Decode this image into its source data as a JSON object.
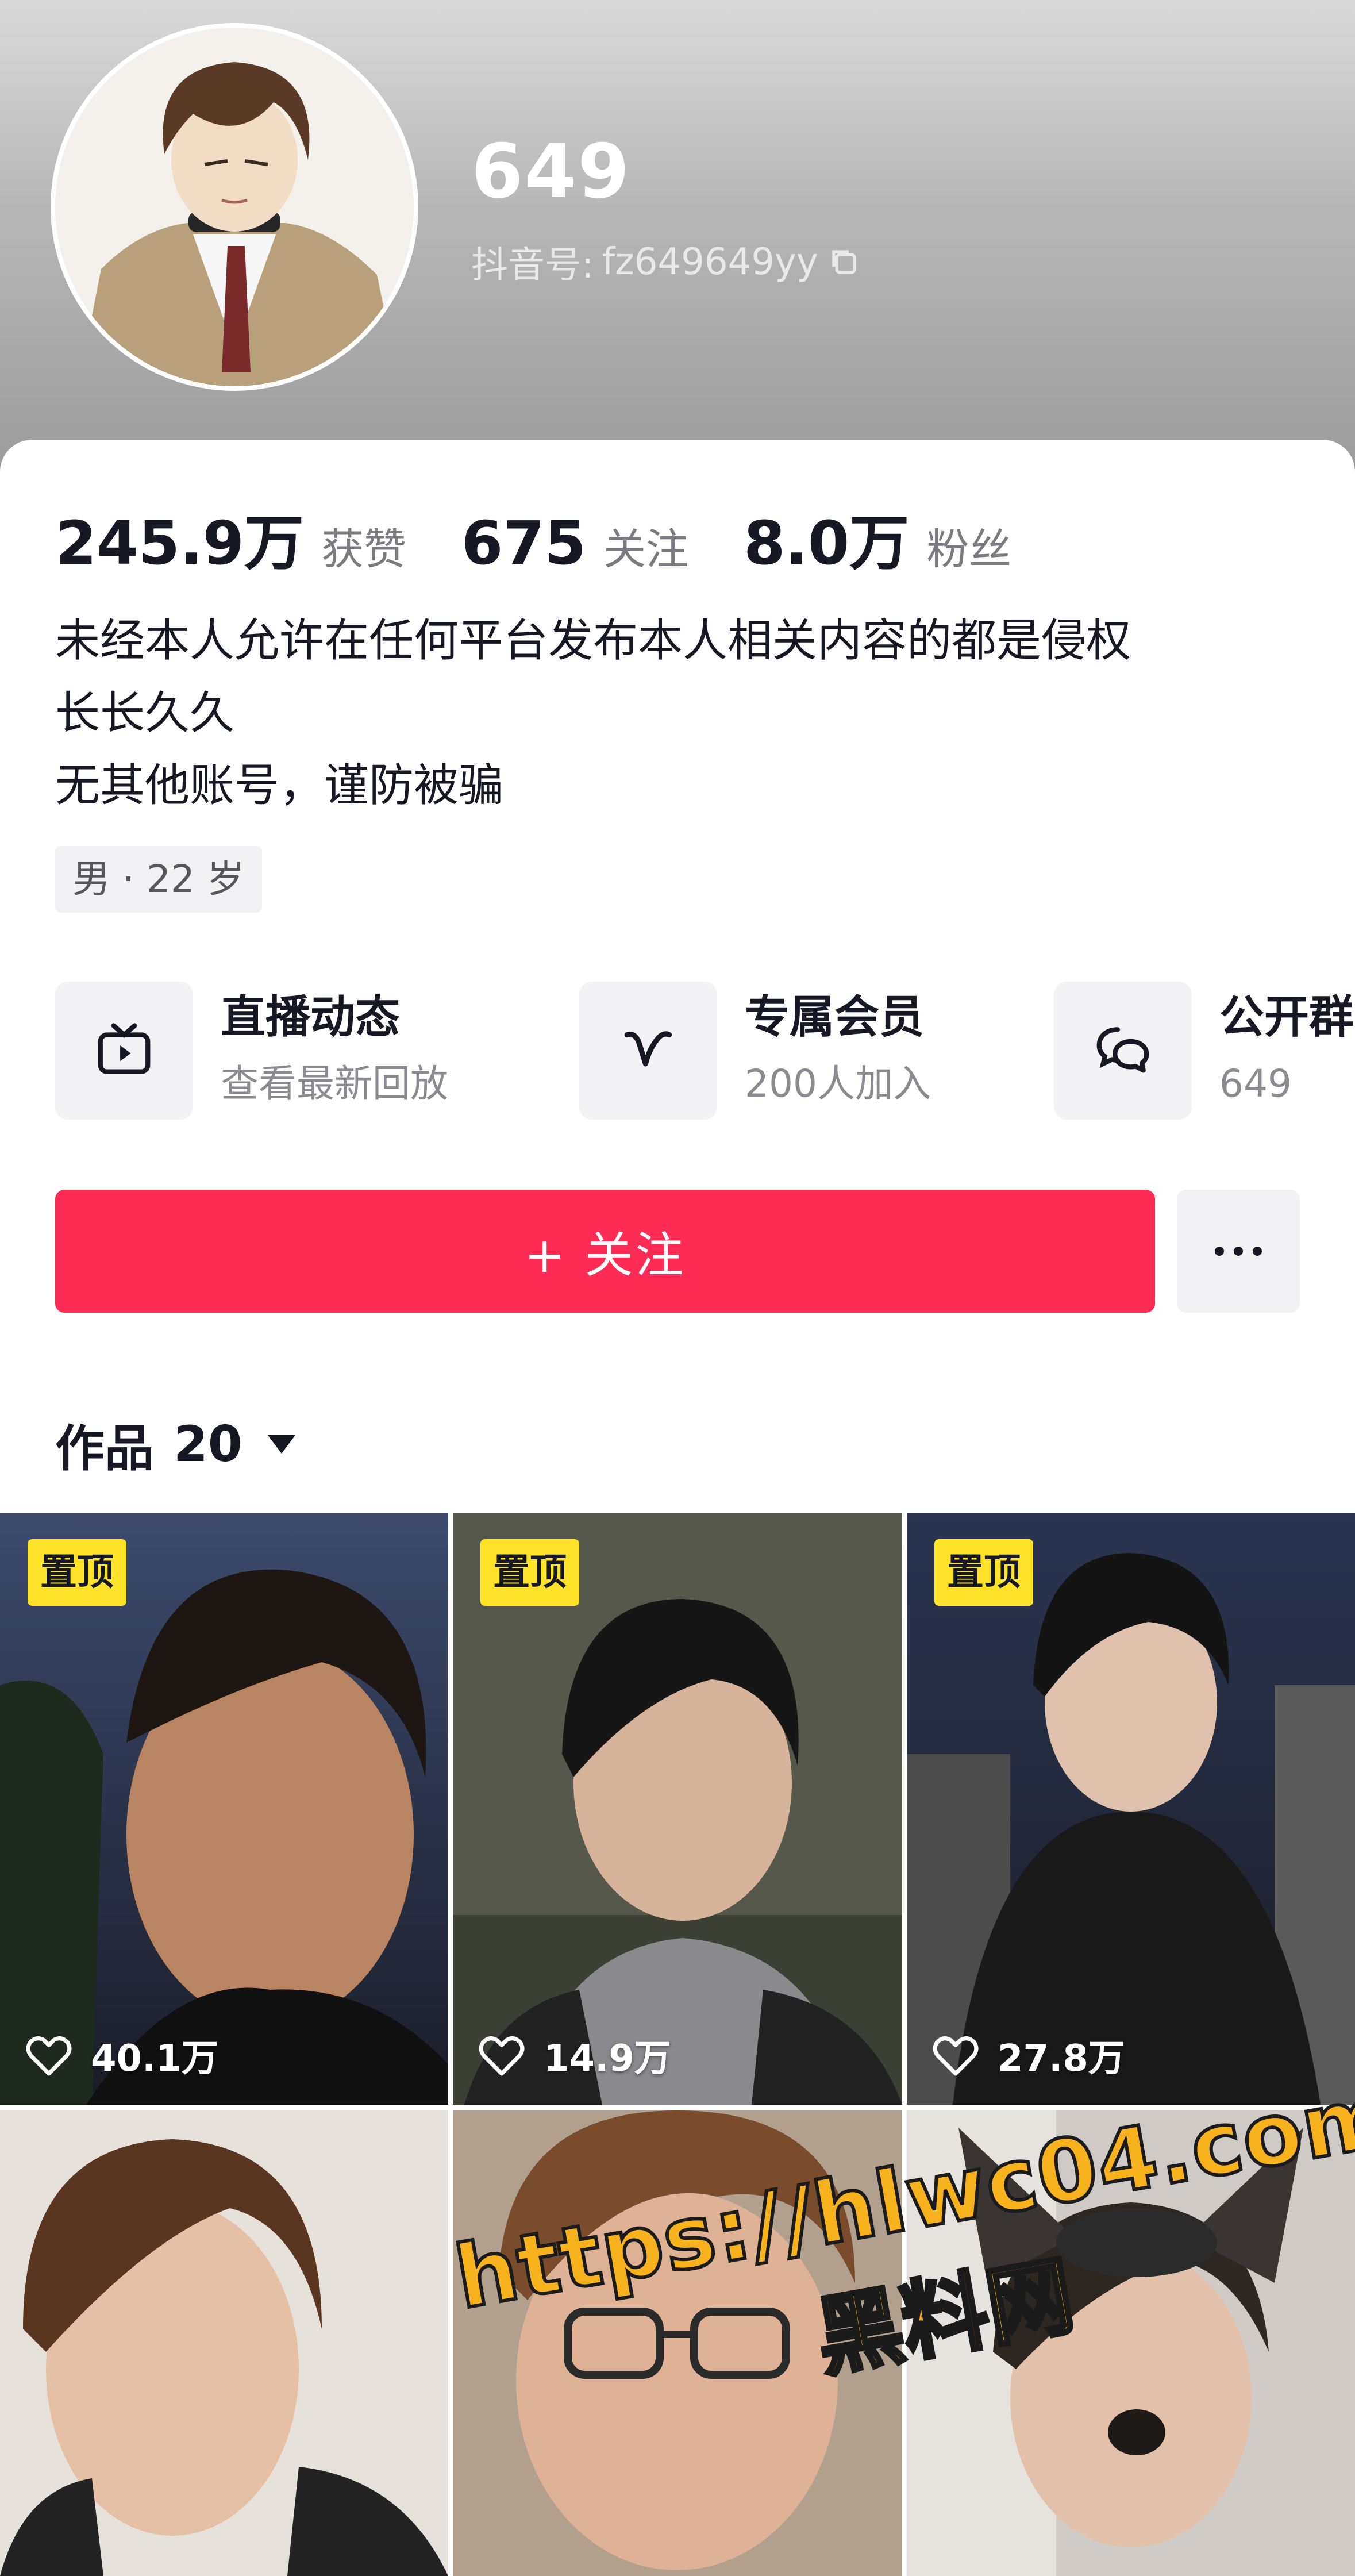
{
  "profile": {
    "name": "649",
    "douyin_id_label": "抖音号:",
    "douyin_id": "fz649649yy"
  },
  "stats": [
    {
      "value": "245.9万",
      "label": "获赞"
    },
    {
      "value": "675",
      "label": "关注"
    },
    {
      "value": "8.0万",
      "label": "粉丝"
    }
  ],
  "bio": {
    "line1": "未经本人允许在任何平台发布本人相关内容的都是侵权",
    "line2": "长长久久",
    "line3": "无其他账号，谨防被骗"
  },
  "tag": "男 · 22 岁",
  "features": [
    {
      "title": "直播动态",
      "subtitle": "查看最新回放",
      "icon": "tv-icon"
    },
    {
      "title": "专属会员",
      "subtitle": "200人加入",
      "icon": "v-icon"
    },
    {
      "title": "公开群",
      "subtitle": "649",
      "icon": "chat-bubbles-icon"
    }
  ],
  "actions": {
    "follow_label": "+ 关注",
    "more_icon": "more-icon"
  },
  "works": {
    "label": "作品",
    "count": "20"
  },
  "videos": [
    {
      "pinned": true,
      "pin_label": "置顶",
      "likes": "40.1万"
    },
    {
      "pinned": true,
      "pin_label": "置顶",
      "likes": "14.9万"
    },
    {
      "pinned": true,
      "pin_label": "置顶",
      "likes": "27.8万"
    },
    {
      "pinned": false
    },
    {
      "pinned": false
    },
    {
      "pinned": false
    }
  ],
  "watermark": {
    "url": "https://hlwc04.com",
    "name": "黑料网"
  },
  "colors": {
    "accent": "#fe2c55",
    "pin_badge": "#fee32a",
    "watermark": "#f7b21d"
  }
}
